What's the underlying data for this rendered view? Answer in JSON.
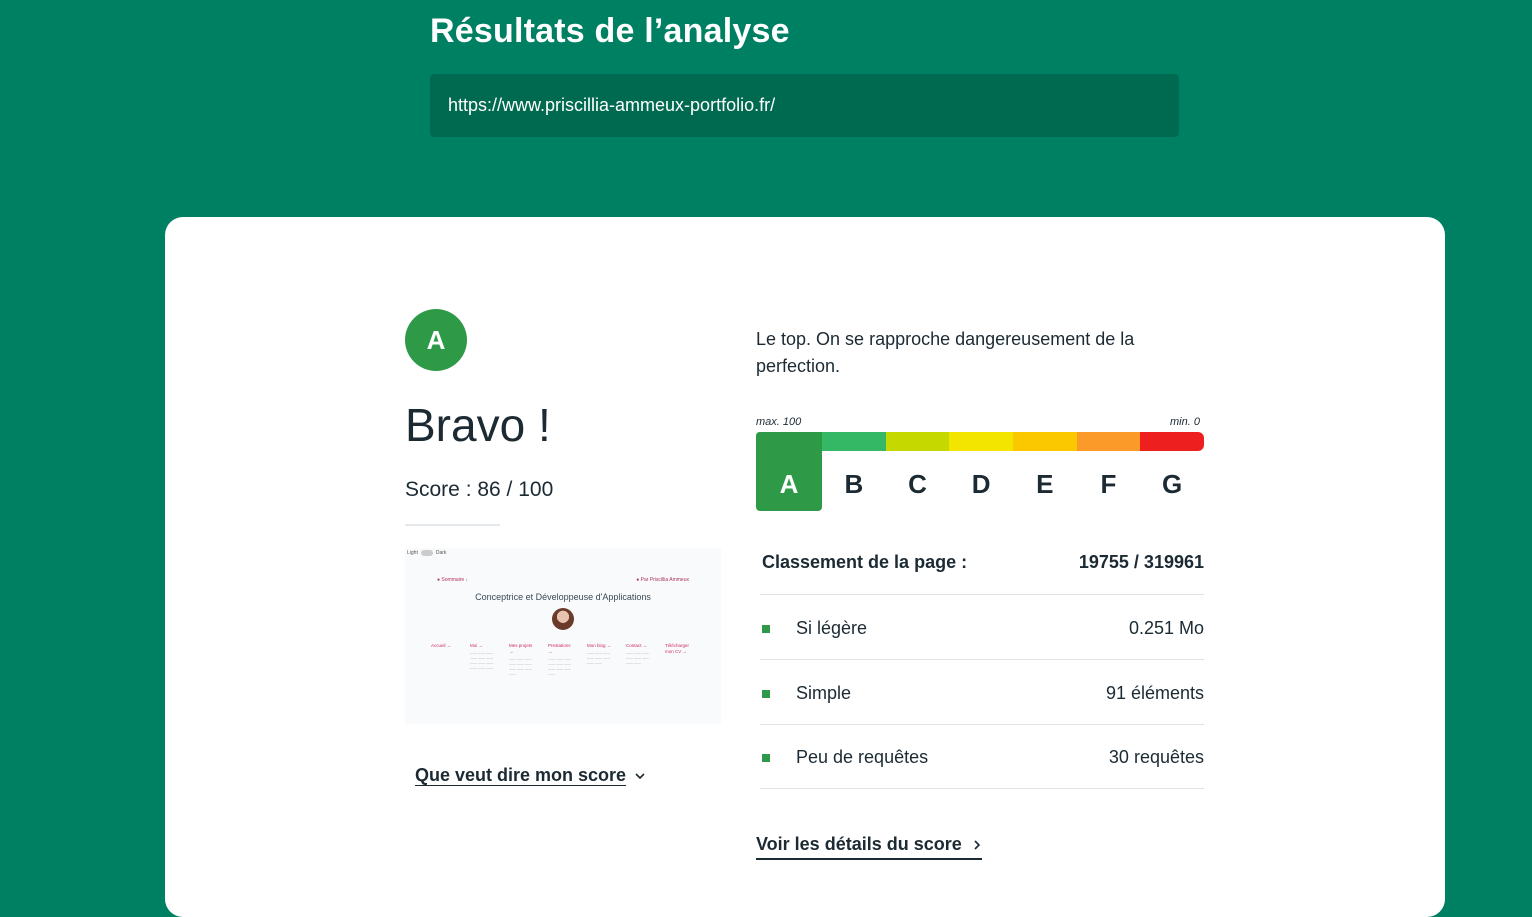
{
  "header": {
    "title": "Résultats de l’analyse",
    "url": "https://www.priscillia-ammeux-portfolio.fr/"
  },
  "result": {
    "grade": "A",
    "headline": "Bravo !",
    "score_label": "Score : 86 / 100",
    "description": "Le top. On se rapproche dangereusement de la perfection.",
    "more_link": "Que veut dire mon score"
  },
  "thumbnail": {
    "toggle_light": "Light",
    "toggle_dark": "Dark",
    "top_left": "● Sommaire ↓",
    "top_right": "● Par Priscillia Ammeux",
    "heading": "Conceptrice et Développeuse d'Applications",
    "nav": [
      "Accueil →",
      "Moi →",
      "Mes projets →",
      "Prestations →",
      "Mon blog →",
      "Contact →",
      "Télécharger mon CV →"
    ]
  },
  "scale": {
    "max_label": "max. 100",
    "min_label": "min. 0",
    "active": "A",
    "grades": [
      {
        "letter": "A",
        "color": "#2e9a47"
      },
      {
        "letter": "B",
        "color": "#34b866"
      },
      {
        "letter": "C",
        "color": "#c5d900"
      },
      {
        "letter": "D",
        "color": "#f4e500"
      },
      {
        "letter": "E",
        "color": "#fbc800"
      },
      {
        "letter": "F",
        "color": "#fb9929"
      },
      {
        "letter": "G",
        "color": "#ee1f1f"
      }
    ]
  },
  "ranking": {
    "label": "Classement de la page :",
    "value": "19755 / 319961"
  },
  "stats": [
    {
      "label": "Si légère",
      "value": "0.251 Mo"
    },
    {
      "label": "Simple",
      "value": "91 éléments"
    },
    {
      "label": "Peu de requêtes",
      "value": "30 requêtes"
    }
  ],
  "details_link": "Voir les détails du score",
  "colors": {
    "background": "#008063",
    "url_box": "#006a51",
    "accent": "#2e9a47"
  }
}
